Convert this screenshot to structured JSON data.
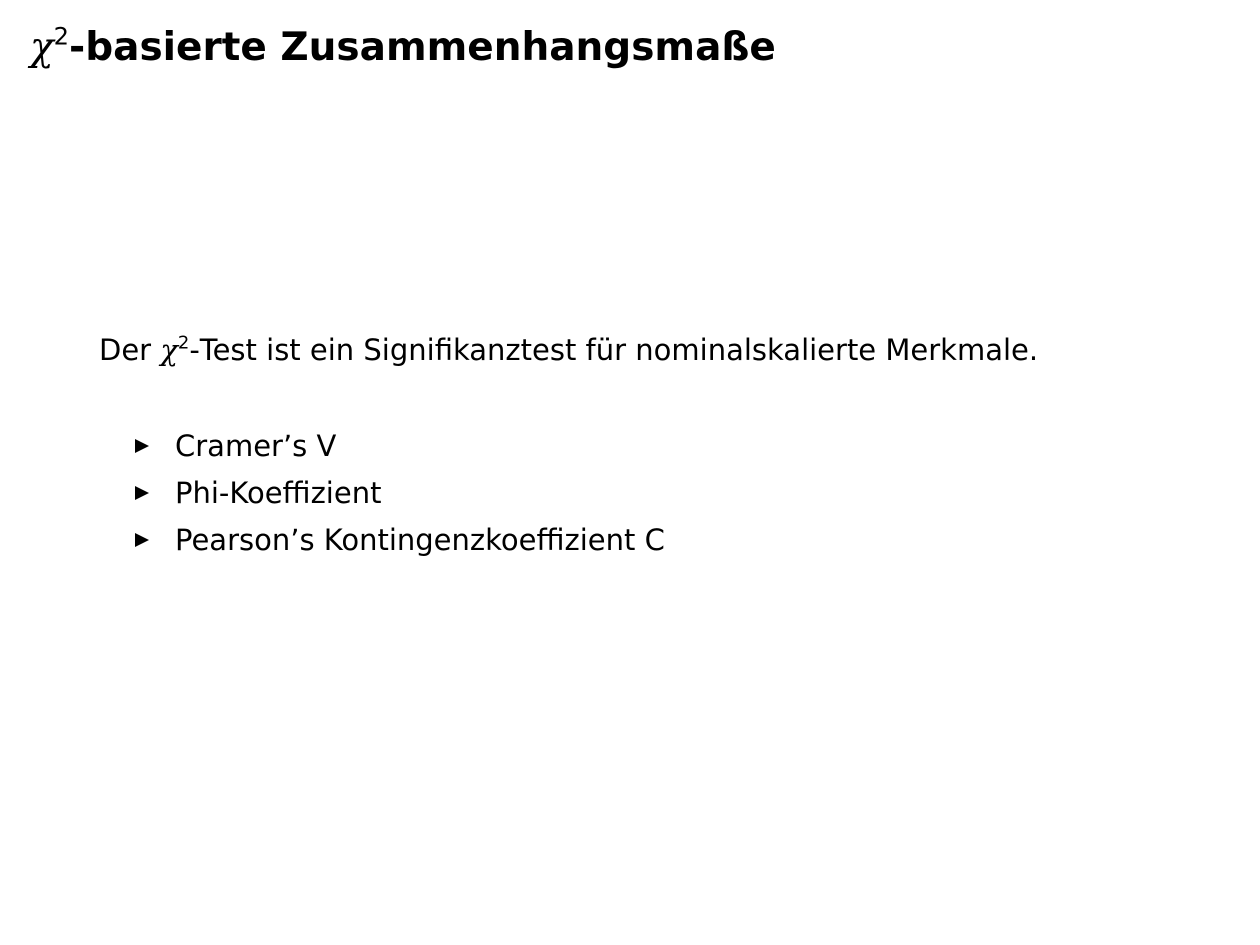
{
  "title": {
    "symbol": "χ",
    "exponent": "2",
    "text": "-basierte Zusammenhangsmaße"
  },
  "intro": {
    "prefix": "Der ",
    "symbol": "χ",
    "exponent": "2",
    "text": "-Test ist ein Signifikanztest für nominalskalierte Merkmale."
  },
  "items": [
    "Cramer’s V",
    "Phi-Koeffizient",
    "Pearson’s Kontingenzkoeffizient C"
  ]
}
